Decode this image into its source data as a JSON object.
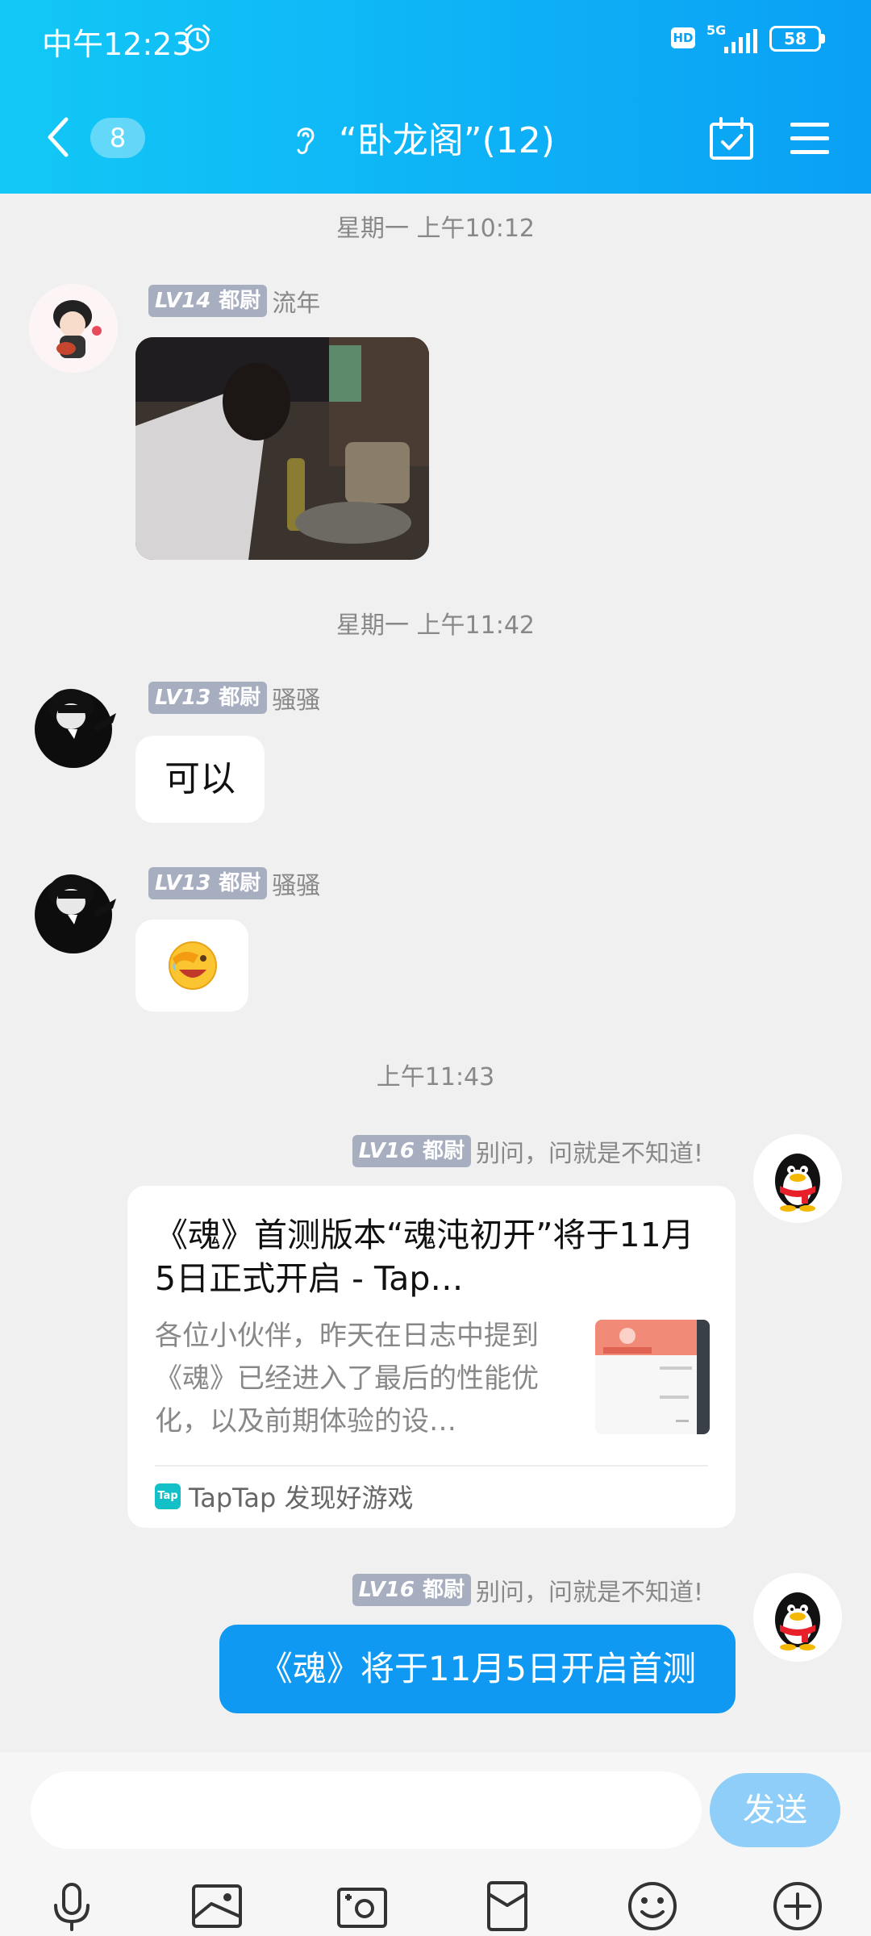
{
  "status_bar": {
    "time": "中午12:23",
    "hd": "HD",
    "network": "5G",
    "battery": "58"
  },
  "header": {
    "unread_count": "8",
    "title": "“卧龙阁”(12)"
  },
  "colors": {
    "header_start": "#12c8f6",
    "header_end": "#0aa0f5",
    "sent_bubble": "#0f99f3",
    "level_badge": "#a6aec0",
    "send_button": "#8ecef8"
  },
  "messages": [
    {
      "timestamp": "星期一 上午10:12",
      "level": "LV14",
      "rank": "都尉",
      "sender": "流年",
      "type": "image"
    },
    {
      "timestamp": "星期一 上午11:42",
      "level": "LV13",
      "rank": "都尉",
      "sender": "骚骚",
      "type": "text",
      "text": "可以"
    },
    {
      "level": "LV13",
      "rank": "都尉",
      "sender": "骚骚",
      "type": "emoji",
      "emoji": "facepalm-laugh"
    },
    {
      "timestamp": "上午11:43",
      "level": "LV16",
      "rank": "都尉",
      "sender": "别问，问就是不知道!",
      "type": "link-card",
      "card": {
        "title": "《魂》首测版本“魂沌初开”将于11月5日正式开启 - Tap…",
        "description": "各位小伙伴，昨天在日志中提到《魂》已经进入了最后的性能优化，以及前期体验的设…",
        "source_logo": "Tap",
        "source": "TapTap 发现好游戏"
      }
    },
    {
      "level": "LV16",
      "rank": "都尉",
      "sender": "别问，问就是不知道!",
      "type": "text",
      "text": "《魂》将于11月5日开启首测"
    }
  ],
  "input": {
    "placeholder": "",
    "send_label": "发送"
  },
  "toolbar": [
    "microphone-icon",
    "image-icon",
    "camera-icon",
    "red-packet-icon",
    "emoji-icon",
    "plus-icon"
  ]
}
